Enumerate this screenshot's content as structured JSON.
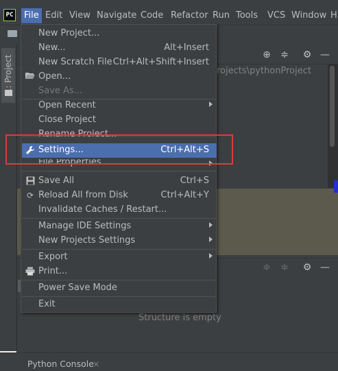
{
  "app": {
    "logo_text": "PC"
  },
  "menubar": {
    "items": [
      "File",
      "Edit",
      "View",
      "Navigate",
      "Code",
      "Refactor",
      "Run",
      "Tools",
      "VCS",
      "Window",
      "H"
    ]
  },
  "left_stripe": {
    "project_tab_label": "1: Project"
  },
  "project_panel": {
    "path_text": "rojects\\pythonProject"
  },
  "structure_panel": {
    "empty_text": "Structure is empty"
  },
  "bottom_bar": {
    "console_tab_label": "Python Console",
    "console_close": "×"
  },
  "file_menu": {
    "items": [
      {
        "label": "New Project...",
        "shortcut": ""
      },
      {
        "label": "New...",
        "shortcut": "Alt+Insert"
      },
      {
        "label": "New Scratch File",
        "shortcut": "Ctrl+Alt+Shift+Insert"
      },
      {
        "label": "Open...",
        "shortcut": ""
      },
      {
        "label": "Save As...",
        "shortcut": ""
      },
      {
        "label": "Open Recent",
        "shortcut": ""
      },
      {
        "label": "Close Project",
        "shortcut": ""
      },
      {
        "label": "Rename Project...",
        "shortcut": ""
      },
      {
        "label": "Settings...",
        "shortcut": "Ctrl+Alt+S"
      },
      {
        "label": "File Properties",
        "shortcut": ""
      },
      {
        "label": "Save All",
        "shortcut": "Ctrl+S"
      },
      {
        "label": "Reload All from Disk",
        "shortcut": "Ctrl+Alt+Y"
      },
      {
        "label": "Invalidate Caches / Restart...",
        "shortcut": ""
      },
      {
        "label": "Manage IDE Settings",
        "shortcut": ""
      },
      {
        "label": "New Projects Settings",
        "shortcut": ""
      },
      {
        "label": "Export",
        "shortcut": ""
      },
      {
        "label": "Print...",
        "shortcut": ""
      },
      {
        "label": "Power Save Mode",
        "shortcut": ""
      },
      {
        "label": "Exit",
        "shortcut": ""
      }
    ]
  },
  "colors": {
    "background": "#3c3f41",
    "selection": "#4b6eaf",
    "highlight_box": "#e03a3a",
    "text": "#bbbbbb"
  }
}
